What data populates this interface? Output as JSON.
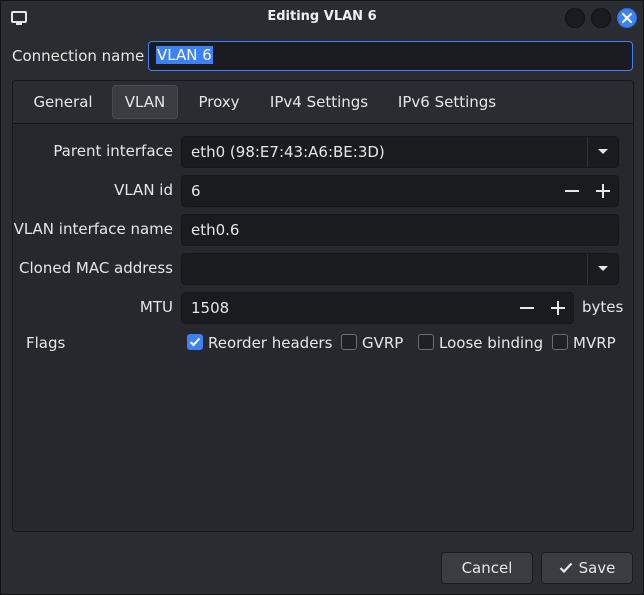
{
  "window": {
    "title": "Editing VLAN 6",
    "icons": {
      "app": "monitor-icon",
      "close": "close-icon"
    },
    "accent_color": "#3c82f6"
  },
  "connection": {
    "label": "Connection name",
    "value": "VLAN 6"
  },
  "tabs": [
    {
      "label": "General",
      "active": false
    },
    {
      "label": "VLAN",
      "active": true
    },
    {
      "label": "Proxy",
      "active": false
    },
    {
      "label": "IPv4 Settings",
      "active": false
    },
    {
      "label": "IPv6 Settings",
      "active": false
    }
  ],
  "vlan": {
    "parent_interface": {
      "label": "Parent interface",
      "value": "eth0 (98:E7:43:A6:BE:3D)"
    },
    "vlan_id": {
      "label": "VLAN id",
      "value": "6"
    },
    "interface_name": {
      "label": "VLAN interface name",
      "value": "eth0.6"
    },
    "cloned_mac": {
      "label": "Cloned MAC address",
      "value": ""
    },
    "mtu": {
      "label": "MTU",
      "value": "1508",
      "unit": "bytes"
    },
    "flags": {
      "label": "Flags",
      "items": [
        {
          "label": "Reorder headers",
          "checked": true
        },
        {
          "label": "GVRP",
          "checked": false
        },
        {
          "label": "Loose binding",
          "checked": false
        },
        {
          "label": "MVRP",
          "checked": false
        }
      ]
    }
  },
  "buttons": {
    "cancel": "Cancel",
    "save": "Save"
  }
}
